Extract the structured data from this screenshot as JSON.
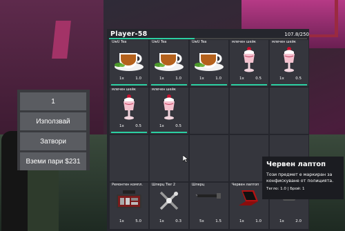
{
  "menu": {
    "items": [
      {
        "label": "1",
        "name": "amount-field"
      },
      {
        "label": "Използвай",
        "name": "use-button"
      },
      {
        "label": "Затвори",
        "name": "close-button"
      },
      {
        "label": "Вземи пари $231",
        "name": "take-money-button"
      }
    ]
  },
  "inventory": {
    "player": "Player-58",
    "weight_text": "107.8/250",
    "weight_fraction": 0.431,
    "accent": "#2bd0a2",
    "slots": [
      {
        "name": "UwU Tea",
        "qty": "1x",
        "weight": "1.0",
        "icon": "tea-cup-icon",
        "bar": true
      },
      {
        "name": "UwU Tea",
        "qty": "1x",
        "weight": "1.0",
        "icon": "tea-cup-icon",
        "bar": true
      },
      {
        "name": "UwU Tea",
        "qty": "1x",
        "weight": "1.0",
        "icon": "tea-cup-icon",
        "bar": true
      },
      {
        "name": "млечен шейк",
        "qty": "1x",
        "weight": "0.5",
        "icon": "milkshake-icon",
        "bar": true
      },
      {
        "name": "млечен шейк",
        "qty": "1x",
        "weight": "0.5",
        "icon": "milkshake-icon",
        "bar": true
      },
      {
        "name": "млечен шейк",
        "qty": "1x",
        "weight": "0.5",
        "icon": "milkshake-icon",
        "bar": true
      },
      {
        "name": "млечен шейк",
        "qty": "1x",
        "weight": "0.5",
        "icon": "milkshake-icon",
        "bar": true
      },
      {
        "name": "",
        "qty": "",
        "weight": "",
        "icon": "",
        "bar": false
      },
      {
        "name": "",
        "qty": "",
        "weight": "",
        "icon": "",
        "bar": false
      },
      {
        "name": "",
        "qty": "",
        "weight": "",
        "icon": "",
        "bar": false
      },
      {
        "name": "",
        "qty": "",
        "weight": "",
        "icon": "",
        "bar": false
      },
      {
        "name": "",
        "qty": "",
        "weight": "",
        "icon": "",
        "bar": false
      },
      {
        "name": "",
        "qty": "",
        "weight": "",
        "icon": "",
        "bar": false
      },
      {
        "name": "",
        "qty": "",
        "weight": "",
        "icon": "",
        "bar": false
      },
      {
        "name": "",
        "qty": "",
        "weight": "",
        "icon": "",
        "bar": false
      },
      {
        "name": "Ремонтен компл.",
        "qty": "1x",
        "weight": "5.0",
        "icon": "repair-kit-icon",
        "bar": false
      },
      {
        "name": "Шперц Tier 2",
        "qty": "1x",
        "weight": "0.3",
        "icon": "lockpick-icon",
        "bar": false
      },
      {
        "name": "Шперц",
        "qty": "5x",
        "weight": "1.5",
        "icon": "lockpick-small-icon",
        "bar": false
      },
      {
        "name": "Червен лаптоп",
        "qty": "1x",
        "weight": "1.0",
        "icon": "laptop-icon",
        "bar": false
      },
      {
        "name": "",
        "qty": "1x",
        "weight": "2.0",
        "icon": "item-icon",
        "bar": false
      }
    ]
  },
  "tooltip": {
    "title": "Червен лаптоп",
    "description": "Този предмет е маркиран за конфискуване от полицията.",
    "meta": "Тегло: 1.0 | Брой: 1"
  }
}
